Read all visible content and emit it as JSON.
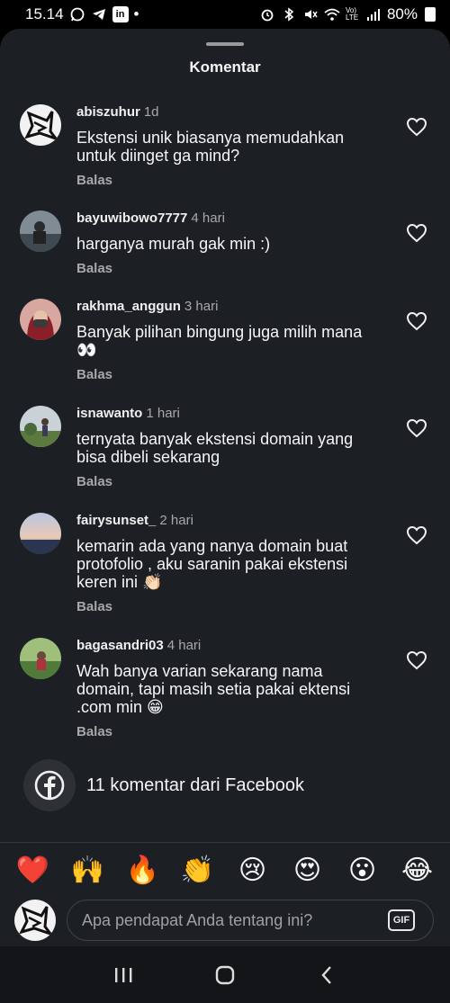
{
  "status_bar": {
    "time": "15.14",
    "battery": "80%",
    "network": "Vo) LTE"
  },
  "sheet": {
    "title": "Komentar"
  },
  "comments": [
    {
      "username": "abiszuhur",
      "time": "1d",
      "text": "Ekstensi unik biasanya memudahkan untuk diinget ga mind?",
      "reply": "Balas"
    },
    {
      "username": "bayuwibowo7777",
      "time": "4 hari",
      "text": "harganya murah gak min :)",
      "reply": "Balas"
    },
    {
      "username": "rakhma_anggun",
      "time": "3 hari",
      "text": "Banyak pilihan bingung juga milih mana 👀",
      "reply": "Balas"
    },
    {
      "username": "isnawanto",
      "time": "1 hari",
      "text": "ternyata banyak ekstensi domain yang bisa dibeli sekarang",
      "reply": "Balas"
    },
    {
      "username": "fairysunset_",
      "time": "2 hari",
      "text": "kemarin ada yang nanya domain buat protofolio , aku saranin pakai ekstensi keren ini 👏🏻",
      "reply": "Balas"
    },
    {
      "username": "bagasandri03",
      "time": "4 hari",
      "text": "Wah banya varian sekarang nama domain, tapi masih setia pakai ektensi .com min 😁",
      "reply": "Balas"
    }
  ],
  "facebook": {
    "label": "11 komentar dari Facebook",
    "icon": "facebook-icon"
  },
  "reactions": [
    "❤️",
    "🙌",
    "🔥",
    "👏",
    "😢",
    "😍",
    "😮",
    "😂"
  ],
  "composer": {
    "placeholder": "Apa pendapat Anda tentang ini?",
    "gif_label": "GIF"
  },
  "colors": {
    "sheet_bg": "#1c1f24",
    "text": "#f5f5f5",
    "muted": "#a8a8a8"
  }
}
